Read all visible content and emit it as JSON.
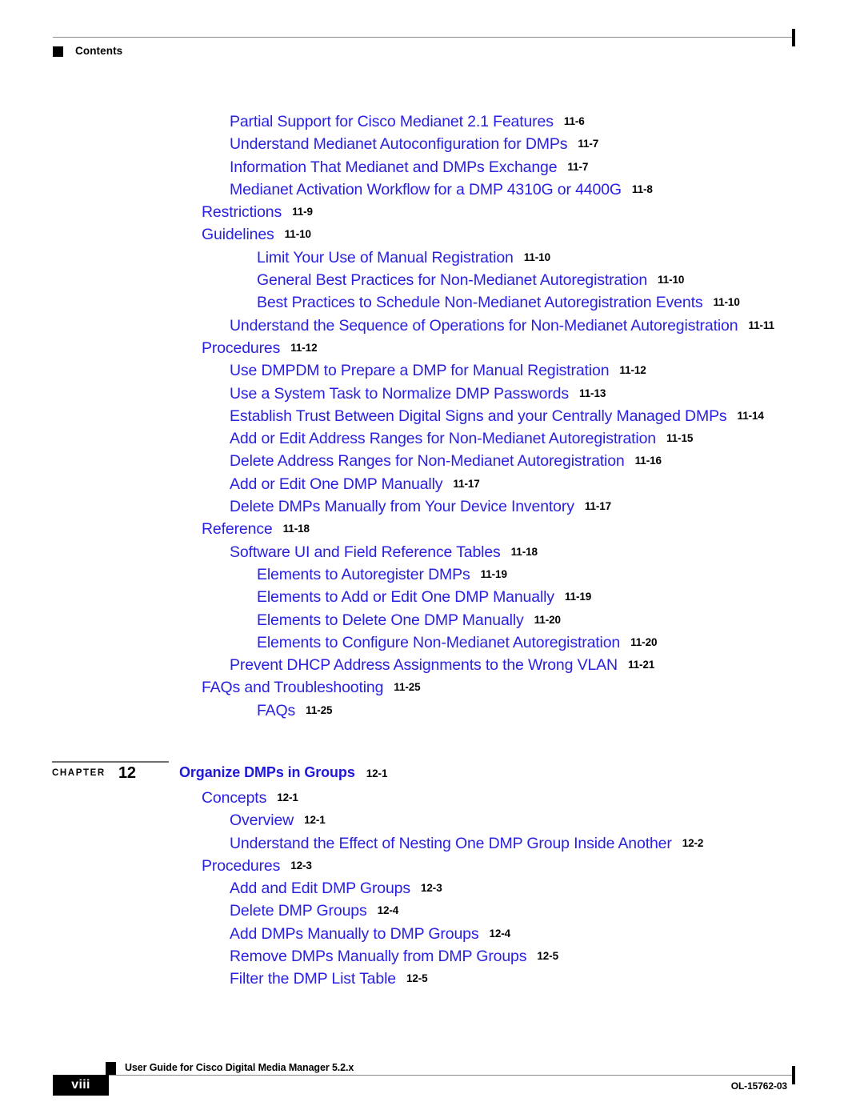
{
  "header": {
    "label": "Contents",
    "marker_icon": "square-marker-icon"
  },
  "toc": {
    "entries": [
      {
        "level": 2,
        "title": "Partial Support for Cisco Medianet 2.1 Features",
        "page": "11-6"
      },
      {
        "level": 2,
        "title": "Understand Medianet Autoconfiguration for DMPs",
        "page": "11-7"
      },
      {
        "level": 2,
        "title": "Information That Medianet and DMPs Exchange",
        "page": "11-7"
      },
      {
        "level": 2,
        "title": "Medianet Activation Workflow for a DMP 4310G or 4400G",
        "page": "11-8"
      },
      {
        "level": 1,
        "title": "Restrictions",
        "page": "11-9"
      },
      {
        "level": 1,
        "title": "Guidelines",
        "page": "11-10"
      },
      {
        "level": 3,
        "title": "Limit Your Use of Manual Registration",
        "page": "11-10"
      },
      {
        "level": 3,
        "title": "General Best Practices for Non-Medianet Autoregistration",
        "page": "11-10"
      },
      {
        "level": 3,
        "title": "Best Practices to Schedule Non-Medianet Autoregistration Events",
        "page": "11-10"
      },
      {
        "level": 2,
        "title": "Understand the Sequence of Operations for Non-Medianet Autoregistration",
        "page": "11-11"
      },
      {
        "level": 1,
        "title": "Procedures",
        "page": "11-12"
      },
      {
        "level": 2,
        "title": "Use DMPDM to Prepare a DMP for Manual Registration",
        "page": "11-12"
      },
      {
        "level": 2,
        "title": "Use a System Task to Normalize DMP Passwords",
        "page": "11-13"
      },
      {
        "level": 2,
        "title": "Establish Trust Between Digital Signs and your Centrally Managed DMPs",
        "page": "11-14"
      },
      {
        "level": 2,
        "title": "Add or Edit Address Ranges for Non-Medianet Autoregistration",
        "page": "11-15"
      },
      {
        "level": 2,
        "title": "Delete Address Ranges for Non-Medianet Autoregistration",
        "page": "11-16"
      },
      {
        "level": 2,
        "title": "Add or Edit One DMP Manually",
        "page": "11-17"
      },
      {
        "level": 2,
        "title": "Delete DMPs Manually from Your Device Inventory",
        "page": "11-17"
      },
      {
        "level": 1,
        "title": "Reference",
        "page": "11-18"
      },
      {
        "level": 2,
        "title": "Software UI and Field Reference Tables",
        "page": "11-18"
      },
      {
        "level": 3,
        "title": "Elements to Autoregister DMPs",
        "page": "11-19"
      },
      {
        "level": 3,
        "title": "Elements to Add or Edit One DMP Manually",
        "page": "11-19"
      },
      {
        "level": 3,
        "title": "Elements to Delete One DMP Manually",
        "page": "11-20"
      },
      {
        "level": 3,
        "title": "Elements to Configure Non-Medianet Autoregistration",
        "page": "11-20"
      },
      {
        "level": 2,
        "title": "Prevent DHCP Address Assignments to the Wrong VLAN",
        "page": "11-21"
      },
      {
        "level": 1,
        "title": "FAQs and Troubleshooting",
        "page": "11-25"
      },
      {
        "level": 3,
        "title": "FAQs",
        "page": "11-25"
      }
    ]
  },
  "chapter": {
    "word": "CHAPTER",
    "number": "12",
    "title": "Organize DMPs in Groups",
    "page": "12-1"
  },
  "toc2": {
    "entries": [
      {
        "level": 1,
        "title": "Concepts",
        "page": "12-1"
      },
      {
        "level": 2,
        "title": "Overview",
        "page": "12-1"
      },
      {
        "level": 2,
        "title": "Understand the Effect of Nesting One DMP Group Inside Another",
        "page": "12-2"
      },
      {
        "level": 1,
        "title": "Procedures",
        "page": "12-3"
      },
      {
        "level": 2,
        "title": "Add and Edit DMP Groups",
        "page": "12-3"
      },
      {
        "level": 2,
        "title": "Delete DMP Groups",
        "page": "12-4"
      },
      {
        "level": 2,
        "title": "Add DMPs Manually to DMP Groups",
        "page": "12-4"
      },
      {
        "level": 2,
        "title": "Remove DMPs Manually from DMP Groups",
        "page": "12-5"
      },
      {
        "level": 2,
        "title": "Filter the DMP List Table",
        "page": "12-5"
      }
    ]
  },
  "footer": {
    "page_number": "viii",
    "guide_title": "User Guide for Cisco Digital Media Manager 5.2.x",
    "doc_id": "OL-15762-03",
    "marker_icon": "square-marker-icon"
  },
  "colors": {
    "link_blue": "#2a21e0",
    "chapter_blue": "#2119d8",
    "rule_gray": "#8a8a8a",
    "black": "#000000"
  }
}
